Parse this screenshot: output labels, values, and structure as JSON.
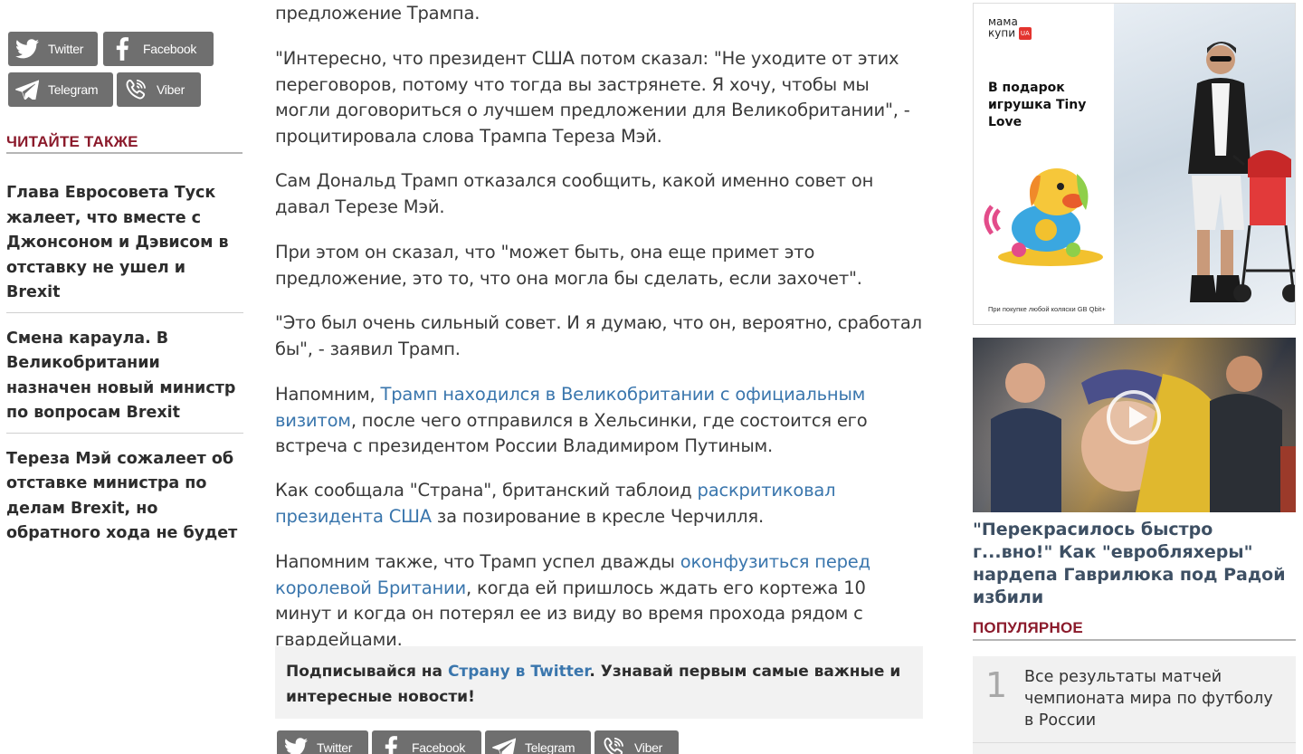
{
  "share_top": [
    {
      "label": "Twitter",
      "icon": "twitter-icon"
    },
    {
      "label": "Facebook",
      "icon": "facebook-icon"
    },
    {
      "label": "Telegram",
      "icon": "telegram-icon"
    },
    {
      "label": "Viber",
      "icon": "viber-icon"
    }
  ],
  "read_also": {
    "heading": "ЧИТАЙТЕ ТАКЖЕ",
    "items": [
      "Глава Евросовета Туск жалеет, что вместе с Джонсоном и Дэвисом в отставку не ушел и Brexit",
      "Смена караула. В Великобритании назначен новый министр по вопросам Brexit",
      "Тереза Мэй сожалеет об отставке министра по делам Brexit, но обратного хода не будет"
    ]
  },
  "article": {
    "p0": "предложение Трампа.",
    "p1": "\"Интересно, что президент США потом сказал: \"Не уходите от этих переговоров, потому что тогда вы застрянете. Я хочу, чтобы мы могли договориться о лучшем предложении для Великобритании\", - процитировала слова Трампа Тереза Мэй.",
    "p2": "Сам Дональд Трамп отказался сообщить, какой именно совет он давал Терезе Мэй.",
    "p3": "При этом он сказал, что \"может быть, она еще примет это предложение, это то, что она могла бы сделать, если захочет\".",
    "p4": "\"Это был очень сильный совет. И я думаю, что он, вероятно, сработал бы\", - заявил Трамп.",
    "p5_pre": "Напомним, ",
    "p5_link": "Трамп находился в Великобритании с официальным визитом",
    "p5_post": ", после чего отправился в Хельсинки, где состоится его встреча с президентом России Владимиром Путиным.",
    "p6_pre": "Как сообщала \"Страна\", британский таблоид ",
    "p6_link": "раскритиковал президента США",
    "p6_post": " за позирование в кресле Черчилля.",
    "p7_pre": "Напомним также, что Трамп успел дважды ",
    "p7_link": "оконфузиться перед королевой Британии",
    "p7_post": ", когда ей пришлось ждать его кортежа 10 минут и когда он потерял ее из виду во время прохода рядом с гвардейцами."
  },
  "subscribe": {
    "pre": "Подписывайся на ",
    "link": "Страну в Twitter",
    "post": ". Узнавай первым самые важные и интересные новости!"
  },
  "share_bottom": [
    {
      "label": "Twitter",
      "icon": "twitter-icon"
    },
    {
      "label": "Facebook",
      "icon": "facebook-icon"
    },
    {
      "label": "Telegram",
      "icon": "telegram-icon"
    },
    {
      "label": "Viber",
      "icon": "viber-icon"
    }
  ],
  "ad": {
    "logo_line1": "мама",
    "logo_line2": "купи",
    "logo_badge": "UA",
    "title": "В подарок игрушка Tiny Love",
    "footnote": "При покупке любой коляски GB Qbit+"
  },
  "video": {
    "title": "\"Перекрасилось быстро г...вно!\" Как \"евробляхеры\" нардепа Гаврилюка под Радой избили"
  },
  "popular": {
    "heading": "ПОПУЛЯРНОЕ",
    "items": [
      {
        "num": "1",
        "title": "Все результаты матчей чемпионата мира по футболу в России"
      }
    ]
  },
  "colors": {
    "section_heading": "#8b1a2b",
    "link": "#3a76ad",
    "share_button": "#6f6f6f"
  }
}
